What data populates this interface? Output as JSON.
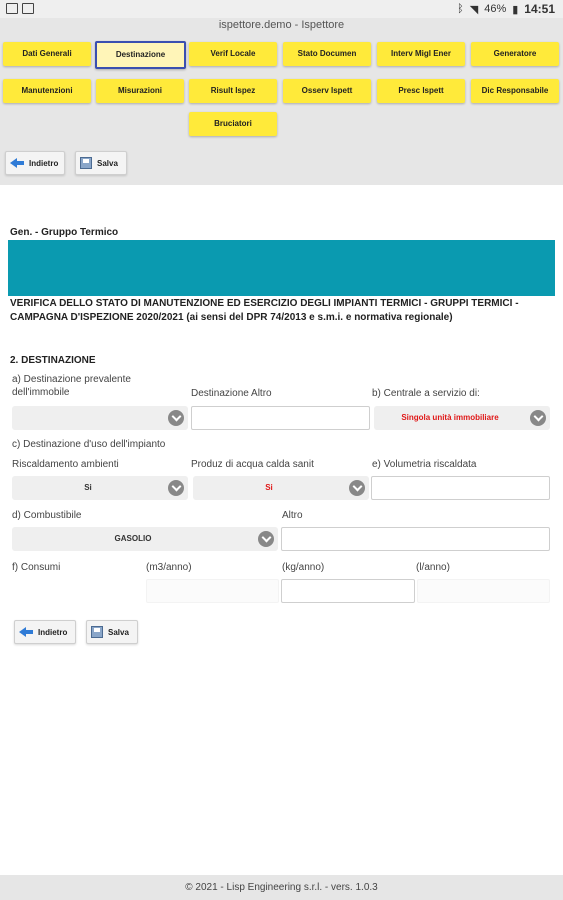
{
  "statusbar": {
    "battery": "46%",
    "time": "14:51"
  },
  "app_title": "ispettore.demo - Ispettore",
  "tabs": [
    {
      "label": "Dati Generali"
    },
    {
      "label": "Destinazione"
    },
    {
      "label": "Verif Locale"
    },
    {
      "label": "Stato Documen"
    },
    {
      "label": "Interv Migl Ener"
    },
    {
      "label": "Generatore"
    },
    {
      "label": "Manutenzioni"
    },
    {
      "label": "Misurazioni"
    },
    {
      "label": "Risult Ispez"
    },
    {
      "label": "Osserv Ispett"
    },
    {
      "label": "Presc Ispett"
    },
    {
      "label": "Dic Responsabile"
    },
    {
      "label": "Bruciatori"
    }
  ],
  "actions": {
    "back": "Indietro",
    "save": "Salva"
  },
  "group_title": "Gen. - Gruppo Termico",
  "heading": "VERIFICA DELLO STATO DI MANUTENZIONE ED ESERCIZIO DEGLI IMPIANTI TERMICI - GRUPPI TERMICI - CAMPAGNA D'ISPEZIONE 2020/2021 (ai sensi del DPR 74/2013 e s.m.i. e normativa regionale)",
  "form": {
    "section": "2. DESTINAZIONE",
    "dest_prev_label": "a) Destinazione prevalente dell'immobile",
    "dest_prev_value": "",
    "dest_altro_label": "Destinazione Altro",
    "centrale_label": "b) Centrale a servizio di:",
    "centrale_value": "Singola unità immobiliare",
    "dest_uso_label": "c) Destinazione d'uso dell'impianto",
    "riscaldamento_label": "Riscaldamento ambienti",
    "riscaldamento_value": "Si",
    "acqua_label": "Produz di acqua calda sanit",
    "acqua_value": "Si",
    "volumetria_label": "e) Volumetria riscaldata",
    "combustibile_label": "d) Combustibile",
    "combustibile_value": "GASOLIO",
    "altro_label": "Altro",
    "consumi_label": "f) Consumi",
    "unit_m3": "(m3/anno)",
    "unit_kg": "(kg/anno)",
    "unit_l": "(l/anno)"
  },
  "footer": "© 2021 - Lisp Engineering s.r.l. - vers. 1.0.3"
}
